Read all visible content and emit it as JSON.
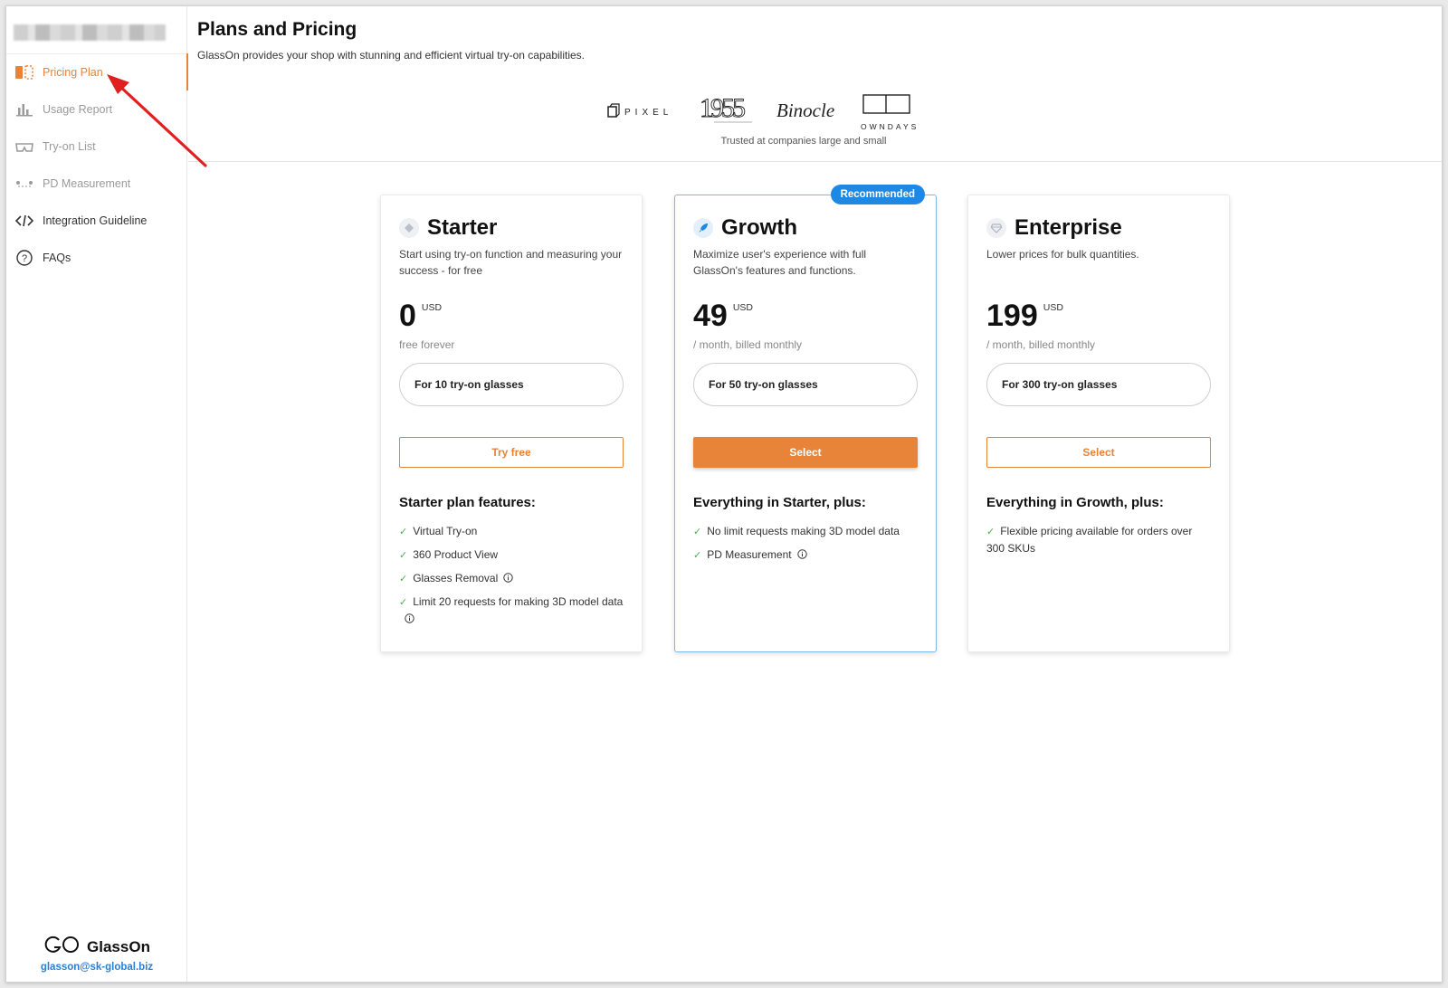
{
  "sidebar": {
    "items": [
      {
        "label": "Pricing Plan",
        "icon": "pricing-plan-icon",
        "active": true
      },
      {
        "label": "Usage Report",
        "icon": "bar-chart-icon"
      },
      {
        "label": "Try-on List",
        "icon": "glasses-icon"
      },
      {
        "label": "PD Measurement",
        "icon": "pd-measurement-icon"
      },
      {
        "label": "Integration Guideline",
        "icon": "code-icon"
      },
      {
        "label": "FAQs",
        "icon": "question-icon"
      }
    ],
    "brand": {
      "name": "GlassOn",
      "email": "glasson@sk-global.biz"
    }
  },
  "header": {
    "title": "Plans and Pricing",
    "subtitle": "GlassOn provides your shop with stunning and efficient virtual try-on capabilities.",
    "logos": [
      "PIXEL",
      "1955",
      "Binocle",
      "OWNDAYS"
    ],
    "trusted": "Trusted at companies large and small"
  },
  "plans": [
    {
      "name": "Starter",
      "description": "Start using try-on function and measuring your success - for free",
      "price": "0",
      "currency": "USD",
      "period": "free forever",
      "capacity": "For 10 try-on glasses",
      "action": "Try free",
      "features_title": "Starter plan features:",
      "features": [
        "Virtual Try-on",
        "360 Product View",
        "Glasses Removal",
        "Limit 20 requests for making 3D model data"
      ]
    },
    {
      "name": "Growth",
      "badge": "Recommended",
      "description": "Maximize user's experience with full GlassOn's features and functions.",
      "price": "49",
      "currency": "USD",
      "period": "/ month, billed monthly",
      "capacity": "For 50 try-on glasses",
      "action": "Select",
      "features_title": "Everything in Starter, plus:",
      "features": [
        "No limit requests making 3D model data",
        "PD Measurement"
      ]
    },
    {
      "name": "Enterprise",
      "description": "Lower prices for bulk quantities.",
      "price": "199",
      "currency": "USD",
      "period": "/ month, billed monthly",
      "capacity": "For 300 try-on glasses",
      "action": "Select",
      "features_title": "Everything in Growth, plus:",
      "features": [
        "Flexible pricing available for orders over 300 SKUs"
      ]
    }
  ],
  "colors": {
    "accent": "#e8833a",
    "badge": "#1e88e5",
    "check": "#4caf50",
    "annotation": "#e02020"
  }
}
